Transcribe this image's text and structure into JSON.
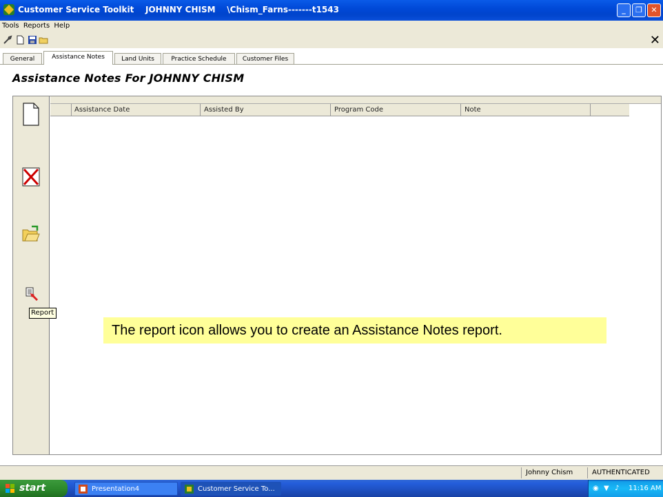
{
  "window": {
    "title": "Customer Service Toolkit    JOHNNY CHISM    \\Chism_Farns-------t1543",
    "app_icon": "toolkit-icon"
  },
  "menubar": {
    "items": [
      "Tools",
      "Reports",
      "Help"
    ]
  },
  "toolbar": {
    "icons": [
      "wrench-icon",
      "new-document-icon",
      "save-icon",
      "open-folder-icon"
    ],
    "close_glyph": "✕"
  },
  "tabs": [
    {
      "label": "General",
      "active": false
    },
    {
      "label": "Assistance Notes",
      "active": true
    },
    {
      "label": "Land Units",
      "active": false
    },
    {
      "label": "Practice Schedule",
      "active": false
    },
    {
      "label": "Customer Files",
      "active": false
    }
  ],
  "page": {
    "title": "Assistance Notes For   JOHNNY CHISM"
  },
  "side_buttons": [
    {
      "name": "new-note-button",
      "icon": "new-document-icon"
    },
    {
      "name": "delete-note-button",
      "icon": "red-x-delete-icon"
    },
    {
      "name": "open-note-button",
      "icon": "open-folder-arrow-icon"
    },
    {
      "name": "report-button",
      "icon": "report-icon"
    }
  ],
  "grid": {
    "columns": [
      "Assistance Date",
      "Assisted By",
      "Program Code",
      "Note"
    ],
    "rows": []
  },
  "tooltip": {
    "text": "Report"
  },
  "callout": {
    "text": "The report icon allows you to create an Assistance Notes report."
  },
  "statusbar": {
    "user": "Johnny Chism",
    "state": "AUTHENTICATED"
  },
  "taskbar": {
    "start_label": "start",
    "items": [
      {
        "label": "Presentation4",
        "icon": "powerpoint-icon",
        "active": false
      },
      {
        "label": "Customer Service To...",
        "icon": "toolkit-icon",
        "active": true
      }
    ],
    "clock": "11:16 AM",
    "tray_icons": [
      "network-icon",
      "shield-icon",
      "volume-icon"
    ]
  },
  "colors": {
    "title_bar": "#0049d8",
    "chrome": "#ece9d8",
    "callout_bg": "#ffff99",
    "delete_red": "#cc0000"
  }
}
